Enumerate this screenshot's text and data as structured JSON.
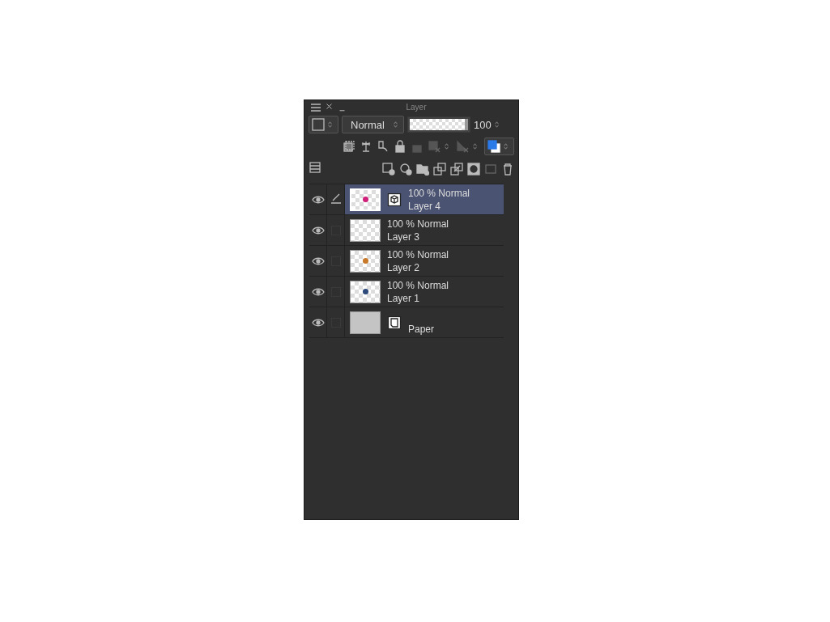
{
  "window": {
    "title": "Layer"
  },
  "blend_mode": {
    "value": "Normal"
  },
  "opacity": {
    "level": 1,
    "reading": "100"
  },
  "layers": [
    {
      "kind": "model",
      "mode": "100 % Normal",
      "name": "Layer 4",
      "selected": true,
      "editing": true,
      "color": "#d0207a"
    },
    {
      "kind": "raster",
      "mode": "100 % Normal",
      "name": "Layer 3",
      "selected": false,
      "editing": false
    },
    {
      "kind": "raster",
      "mode": "100 % Normal",
      "name": "Layer 2",
      "selected": false,
      "editing": false,
      "color": "#c87a2a"
    },
    {
      "kind": "raster",
      "mode": "100 % Normal",
      "name": "Layer 1",
      "selected": false,
      "editing": false,
      "color": "#2d4a7a"
    },
    {
      "kind": "paper",
      "name": "Paper",
      "selected": false,
      "editing": false
    }
  ]
}
